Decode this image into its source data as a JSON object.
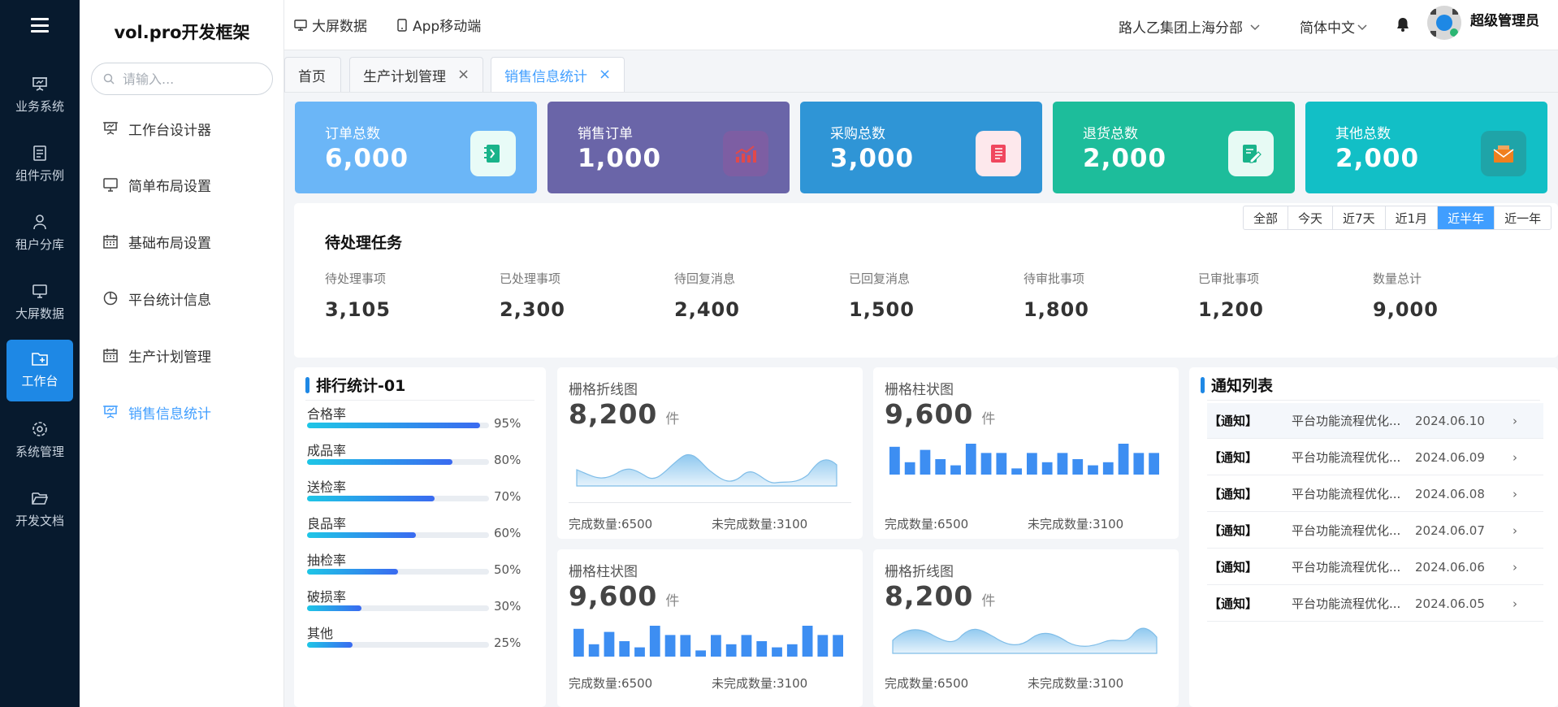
{
  "nav": {
    "items": [
      {
        "label": "业务系统"
      },
      {
        "label": "组件示例"
      },
      {
        "label": "租户分库"
      },
      {
        "label": "大屏数据"
      },
      {
        "label": "工作台"
      },
      {
        "label": "系统管理"
      },
      {
        "label": "开发文档"
      }
    ]
  },
  "sidebar": {
    "brand": "vol.pro开发框架",
    "search_placeholder": "请输入...",
    "items": [
      {
        "label": "工作台设计器"
      },
      {
        "label": "简单布局设置"
      },
      {
        "label": "基础布局设置"
      },
      {
        "label": "平台统计信息"
      },
      {
        "label": "生产计划管理"
      },
      {
        "label": "销售信息统计"
      }
    ]
  },
  "header": {
    "big_screen": "大屏数据",
    "app": "App移动端",
    "org": "路人乙集团上海分部",
    "lang": "简体中文",
    "user": "超级管理员"
  },
  "tabs": [
    {
      "label": "首页"
    },
    {
      "label": "生产计划管理"
    },
    {
      "label": "销售信息统计"
    }
  ],
  "cards": [
    {
      "label": "订单总数",
      "value": "6,000",
      "color": "#6bb6f7"
    },
    {
      "label": "销售订单",
      "value": "1,000",
      "color": "#6a65a8"
    },
    {
      "label": "采购总数",
      "value": "3,000",
      "color": "#2f95d6"
    },
    {
      "label": "退货总数",
      "value": "2,000",
      "color": "#1dbd9b"
    },
    {
      "label": "其他总数",
      "value": "2,000",
      "color": "#12bfc6"
    }
  ],
  "pending": {
    "title": "待处理任务",
    "ranges": [
      "全部",
      "今天",
      "近7天",
      "近1月",
      "近半年",
      "近一年"
    ],
    "selected_range": "近半年",
    "metrics": [
      {
        "label": "待处理事项",
        "value": "3,105"
      },
      {
        "label": "已处理事项",
        "value": "2,300"
      },
      {
        "label": "待回复消息",
        "value": "2,400"
      },
      {
        "label": "已回复消息",
        "value": "1,500"
      },
      {
        "label": "待审批事项",
        "value": "1,800"
      },
      {
        "label": "已审批事项",
        "value": "1,200"
      },
      {
        "label": "数量总计",
        "value": "9,000"
      }
    ]
  },
  "ranking": {
    "title": "排行统计-01",
    "items": [
      {
        "label": "合格率",
        "pct": "95%",
        "value": 0.95
      },
      {
        "label": "成品率",
        "pct": "80%",
        "value": 0.8
      },
      {
        "label": "送检率",
        "pct": "70%",
        "value": 0.7
      },
      {
        "label": "良品率",
        "pct": "60%",
        "value": 0.6
      },
      {
        "label": "抽检率",
        "pct": "50%",
        "value": 0.5
      },
      {
        "label": "破损率",
        "pct": "30%",
        "value": 0.3
      },
      {
        "label": "其他",
        "pct": "25%",
        "value": 0.25
      }
    ]
  },
  "mini_charts": [
    {
      "title": "栅格折线图",
      "value": "8,200",
      "unit": "件",
      "done": "完成数量:6500",
      "undone": "未完成数量:3100"
    },
    {
      "title": "栅格柱状图",
      "value": "9,600",
      "unit": "件",
      "done": "完成数量:6500",
      "undone": "未完成数量:3100"
    },
    {
      "title": "栅格柱状图",
      "value": "9,600",
      "unit": "件",
      "done": "完成数量:6500",
      "undone": "未完成数量:3100"
    },
    {
      "title": "栅格折线图",
      "value": "8,200",
      "unit": "件",
      "done": "完成数量:6500",
      "undone": "未完成数量:3100"
    }
  ],
  "chart_data": {
    "type": "bar",
    "series": [
      {
        "values": [
          9,
          4,
          8,
          5,
          3,
          10,
          7,
          7,
          2,
          7,
          4,
          7,
          5,
          3,
          4,
          10,
          7,
          7
        ]
      }
    ]
  },
  "notices": {
    "title": "通知列表",
    "items": [
      {
        "tag": "【通知】",
        "text": "平台功能流程优化...",
        "date": "2024.06.10"
      },
      {
        "tag": "【通知】",
        "text": "平台功能流程优化...",
        "date": "2024.06.09"
      },
      {
        "tag": "【通知】",
        "text": "平台功能流程优化...",
        "date": "2024.06.08"
      },
      {
        "tag": "【通知】",
        "text": "平台功能流程优化...",
        "date": "2024.06.07"
      },
      {
        "tag": "【通知】",
        "text": "平台功能流程优化...",
        "date": "2024.06.06"
      },
      {
        "tag": "【通知】",
        "text": "平台功能流程优化...",
        "date": "2024.06.05"
      }
    ]
  }
}
